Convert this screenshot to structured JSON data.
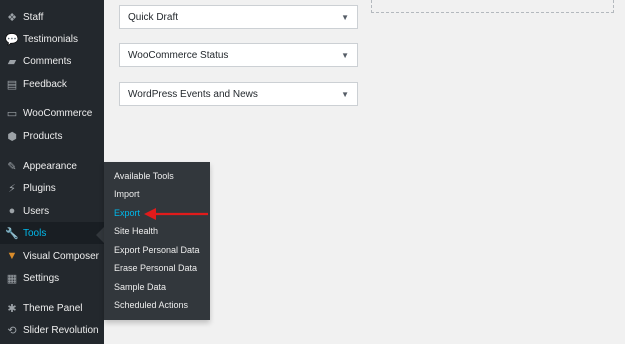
{
  "sidebar": {
    "items": [
      {
        "label": "Staff",
        "icon": "staff-icon",
        "glyph": "❖"
      },
      {
        "label": "Testimonials",
        "icon": "testimonials-icon",
        "glyph": "💬"
      },
      {
        "label": "Comments",
        "icon": "comments-icon",
        "glyph": "▰"
      },
      {
        "label": "Feedback",
        "icon": "feedback-icon",
        "glyph": "▤"
      },
      {
        "label": "WooCommerce",
        "icon": "woocommerce-icon",
        "glyph": "▭"
      },
      {
        "label": "Products",
        "icon": "products-icon",
        "glyph": "⬢"
      },
      {
        "label": "Appearance",
        "icon": "appearance-icon",
        "glyph": "✎"
      },
      {
        "label": "Plugins",
        "icon": "plugins-icon",
        "glyph": "⚡"
      },
      {
        "label": "Users",
        "icon": "users-icon",
        "glyph": "●"
      },
      {
        "label": "Tools",
        "icon": "tools-icon",
        "glyph": "🔧"
      },
      {
        "label": "Visual Composer",
        "icon": "visual-composer-icon",
        "glyph": "▼"
      },
      {
        "label": "Settings",
        "icon": "settings-icon",
        "glyph": "▦"
      },
      {
        "label": "Theme Panel",
        "icon": "theme-panel-icon",
        "glyph": "✱"
      },
      {
        "label": "Slider Revolution",
        "icon": "slider-revolution-icon",
        "glyph": "⟲"
      }
    ]
  },
  "flyout": {
    "items": [
      {
        "label": "Available Tools"
      },
      {
        "label": "Import"
      },
      {
        "label": "Export"
      },
      {
        "label": "Site Health"
      },
      {
        "label": "Export Personal Data"
      },
      {
        "label": "Erase Personal Data"
      },
      {
        "label": "Sample Data"
      },
      {
        "label": "Scheduled Actions"
      }
    ]
  },
  "panels": [
    {
      "title": "Quick Draft"
    },
    {
      "title": "WooCommerce Status"
    },
    {
      "title": "WordPress Events and News"
    }
  ],
  "colors": {
    "sidebar_bg": "#23282d",
    "active_text": "#00b9eb",
    "annotation_arrow": "#e01b1b"
  }
}
